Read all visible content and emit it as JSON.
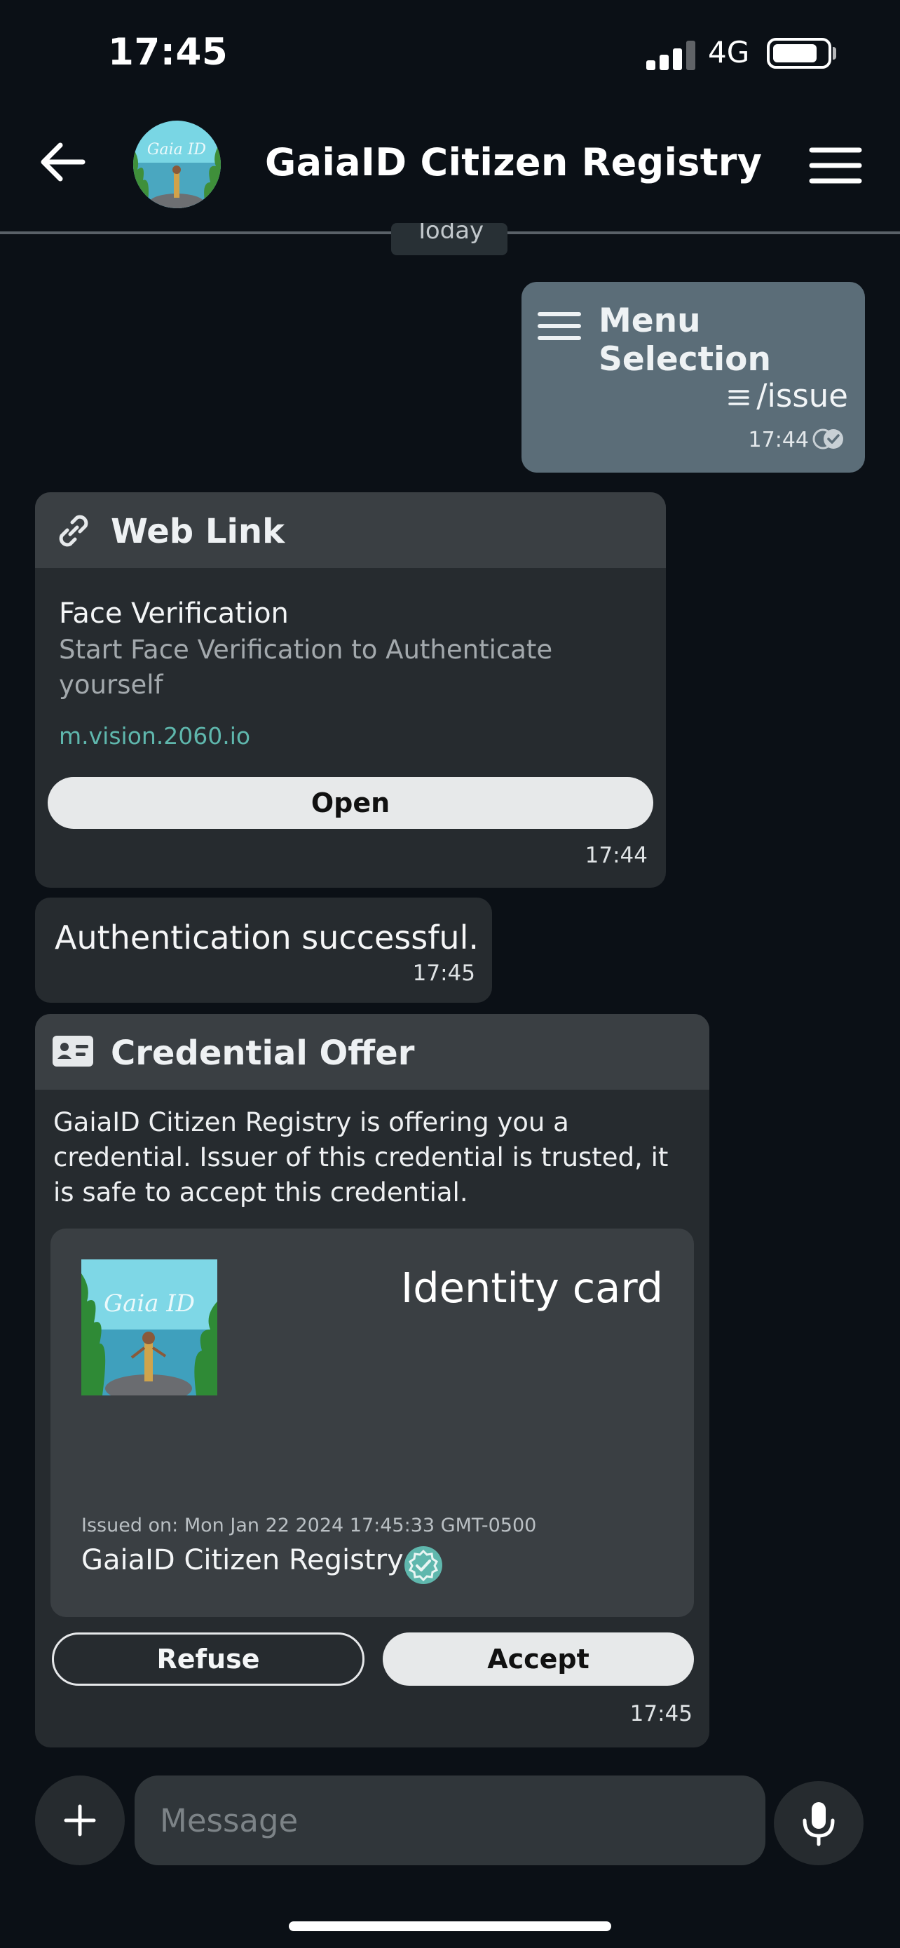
{
  "status_bar": {
    "time": "17:45",
    "network": "4G",
    "signal_bars": 3,
    "battery_level": 0.85
  },
  "header": {
    "title": "GaiaID Citizen Registry",
    "back_icon": "arrow-left-icon",
    "menu_icon": "hamburger-menu-icon",
    "avatar_text": "Gaia ID"
  },
  "date_separator": "Today",
  "outgoing_message": {
    "title": "Menu Selection",
    "title_icon": "menu-lines-icon",
    "command": "/issue",
    "command_icon": "list-icon",
    "time": "17:44",
    "status_icon": "double-check-icon"
  },
  "web_link_card": {
    "header_title": "Web Link",
    "header_icon": "link-icon",
    "name": "Face Verification",
    "description": "Start Face Verification to Authenticate yourself",
    "url": "m.vision.2060.io",
    "open_label": "Open",
    "time": "17:44"
  },
  "auth_message": {
    "text": "Authentication successful.",
    "time": "17:45"
  },
  "credential_offer": {
    "header_title": "Credential Offer",
    "header_icon": "id-card-icon",
    "description": "GaiaID Citizen Registry is offering you a credential. Issuer of this credential is trusted, it is safe to accept this credential.",
    "card": {
      "title": "Identity card",
      "image_text": "Gaia ID",
      "issued_on": "Issued on: Mon Jan 22 2024 17:45:33 GMT-0500",
      "issuer": "GaiaID Citizen Registry",
      "verified_icon": "verified-badge-icon"
    },
    "refuse_label": "Refuse",
    "accept_label": "Accept",
    "time": "17:45"
  },
  "composer": {
    "placeholder": "Message",
    "plus_icon": "plus-icon",
    "mic_icon": "microphone-icon"
  },
  "colors": {
    "background": "#0b1016",
    "bubble": "#262b2f",
    "card_header": "#3a3f43",
    "outgoing_bubble": "#5b6d78",
    "link": "#5fb7ad",
    "verified": "#5fb7ad"
  }
}
